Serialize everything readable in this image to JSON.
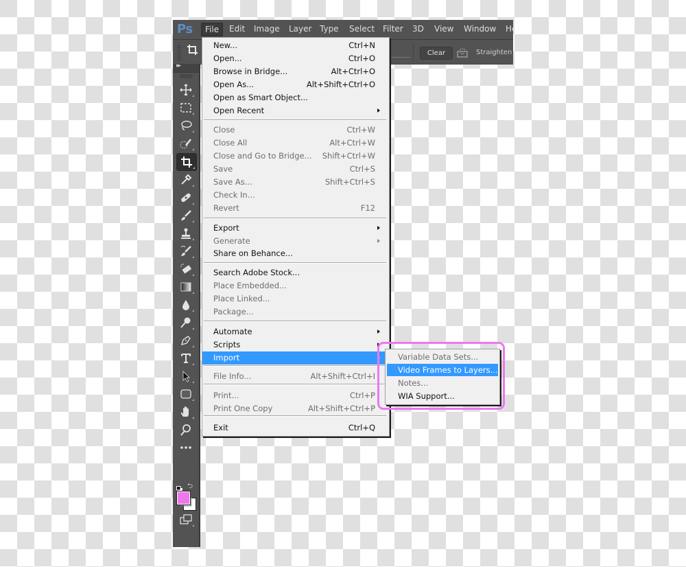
{
  "app": {
    "logo": "Ps",
    "menubar": [
      "File",
      "Edit",
      "Image",
      "Layer",
      "Type",
      "Select",
      "Filter",
      "3D",
      "View",
      "Window",
      "He"
    ],
    "active_menu": "File"
  },
  "options_bar": {
    "clear_label": "Clear",
    "straighten_label": "Straighten"
  },
  "toolbar": {
    "tools": [
      {
        "name": "move-tool",
        "icon": "move-icon"
      },
      {
        "name": "marquee-tool",
        "icon": "rect-marquee-icon"
      },
      {
        "name": "lasso-tool",
        "icon": "lasso-icon"
      },
      {
        "name": "quick-selection-tool",
        "icon": "quick-select-icon"
      },
      {
        "name": "crop-tool",
        "icon": "crop-icon",
        "selected": true
      },
      {
        "name": "eyedropper-tool",
        "icon": "eyedropper-icon"
      },
      {
        "name": "healing-brush-tool",
        "icon": "bandage-icon"
      },
      {
        "name": "brush-tool",
        "icon": "brush-icon"
      },
      {
        "name": "clone-stamp-tool",
        "icon": "stamp-icon"
      },
      {
        "name": "history-brush-tool",
        "icon": "history-brush-icon"
      },
      {
        "name": "eraser-tool",
        "icon": "eraser-icon"
      },
      {
        "name": "gradient-tool",
        "icon": "gradient-icon"
      },
      {
        "name": "blur-tool",
        "icon": "drop-icon"
      },
      {
        "name": "dodge-tool",
        "icon": "dodge-icon"
      },
      {
        "name": "pen-tool",
        "icon": "pen-icon"
      },
      {
        "name": "type-tool",
        "icon": "type-icon"
      },
      {
        "name": "path-selection-tool",
        "icon": "arrow-icon"
      },
      {
        "name": "shape-tool",
        "icon": "rounded-rect-icon"
      },
      {
        "name": "hand-tool",
        "icon": "hand-icon"
      },
      {
        "name": "zoom-tool",
        "icon": "magnifier-icon"
      },
      {
        "name": "more-tools",
        "icon": "ellipsis-icon"
      }
    ],
    "foreground_color": "#ee77ee",
    "background_color": "#ffffff"
  },
  "file_menu": {
    "items": [
      {
        "label": "New...",
        "shortcut": "Ctrl+N",
        "state": "enabled"
      },
      {
        "label": "Open...",
        "shortcut": "Ctrl+O",
        "state": "enabled"
      },
      {
        "label": "Browse in Bridge...",
        "shortcut": "Alt+Ctrl+O",
        "state": "enabled"
      },
      {
        "label": "Open As...",
        "shortcut": "Alt+Shift+Ctrl+O",
        "state": "enabled"
      },
      {
        "label": "Open as Smart Object...",
        "shortcut": "",
        "state": "enabled"
      },
      {
        "label": "Open Recent",
        "shortcut": "",
        "state": "enabled",
        "submenu": true
      },
      {
        "label": "Close",
        "shortcut": "Ctrl+W",
        "state": "disabled"
      },
      {
        "label": "Close All",
        "shortcut": "Alt+Ctrl+W",
        "state": "disabled"
      },
      {
        "label": "Close and Go to Bridge...",
        "shortcut": "Shift+Ctrl+W",
        "state": "disabled"
      },
      {
        "label": "Save",
        "shortcut": "Ctrl+S",
        "state": "disabled"
      },
      {
        "label": "Save As...",
        "shortcut": "Shift+Ctrl+S",
        "state": "disabled"
      },
      {
        "label": "Check In...",
        "shortcut": "",
        "state": "disabled"
      },
      {
        "label": "Revert",
        "shortcut": "F12",
        "state": "disabled"
      },
      {
        "label": "Export",
        "shortcut": "",
        "state": "enabled",
        "submenu": true
      },
      {
        "label": "Generate",
        "shortcut": "",
        "state": "disabled",
        "submenu": true
      },
      {
        "label": "Share on Behance...",
        "shortcut": "",
        "state": "enabled"
      },
      {
        "label": "Search Adobe Stock...",
        "shortcut": "",
        "state": "enabled"
      },
      {
        "label": "Place Embedded...",
        "shortcut": "",
        "state": "disabled"
      },
      {
        "label": "Place Linked...",
        "shortcut": "",
        "state": "disabled"
      },
      {
        "label": "Package...",
        "shortcut": "",
        "state": "disabled"
      },
      {
        "label": "Automate",
        "shortcut": "",
        "state": "enabled",
        "submenu": true
      },
      {
        "label": "Scripts",
        "shortcut": "",
        "state": "enabled",
        "submenu": true
      },
      {
        "label": "Import",
        "shortcut": "",
        "state": "highlight",
        "submenu": true
      },
      {
        "label": "File Info...",
        "shortcut": "Alt+Shift+Ctrl+I",
        "state": "disabled"
      },
      {
        "label": "Print...",
        "shortcut": "Ctrl+P",
        "state": "disabled"
      },
      {
        "label": "Print One Copy",
        "shortcut": "Alt+Shift+Ctrl+P",
        "state": "disabled"
      },
      {
        "label": "Exit",
        "shortcut": "Ctrl+Q",
        "state": "enabled"
      }
    ]
  },
  "import_submenu": {
    "items": [
      {
        "label": "Variable Data Sets...",
        "state": "disabled"
      },
      {
        "label": "Video Frames to Layers...",
        "state": "highlight"
      },
      {
        "label": "Notes...",
        "state": "disabled"
      },
      {
        "label": "WIA Support...",
        "state": "enabled"
      }
    ],
    "annotation_color": "#ee77ee"
  }
}
